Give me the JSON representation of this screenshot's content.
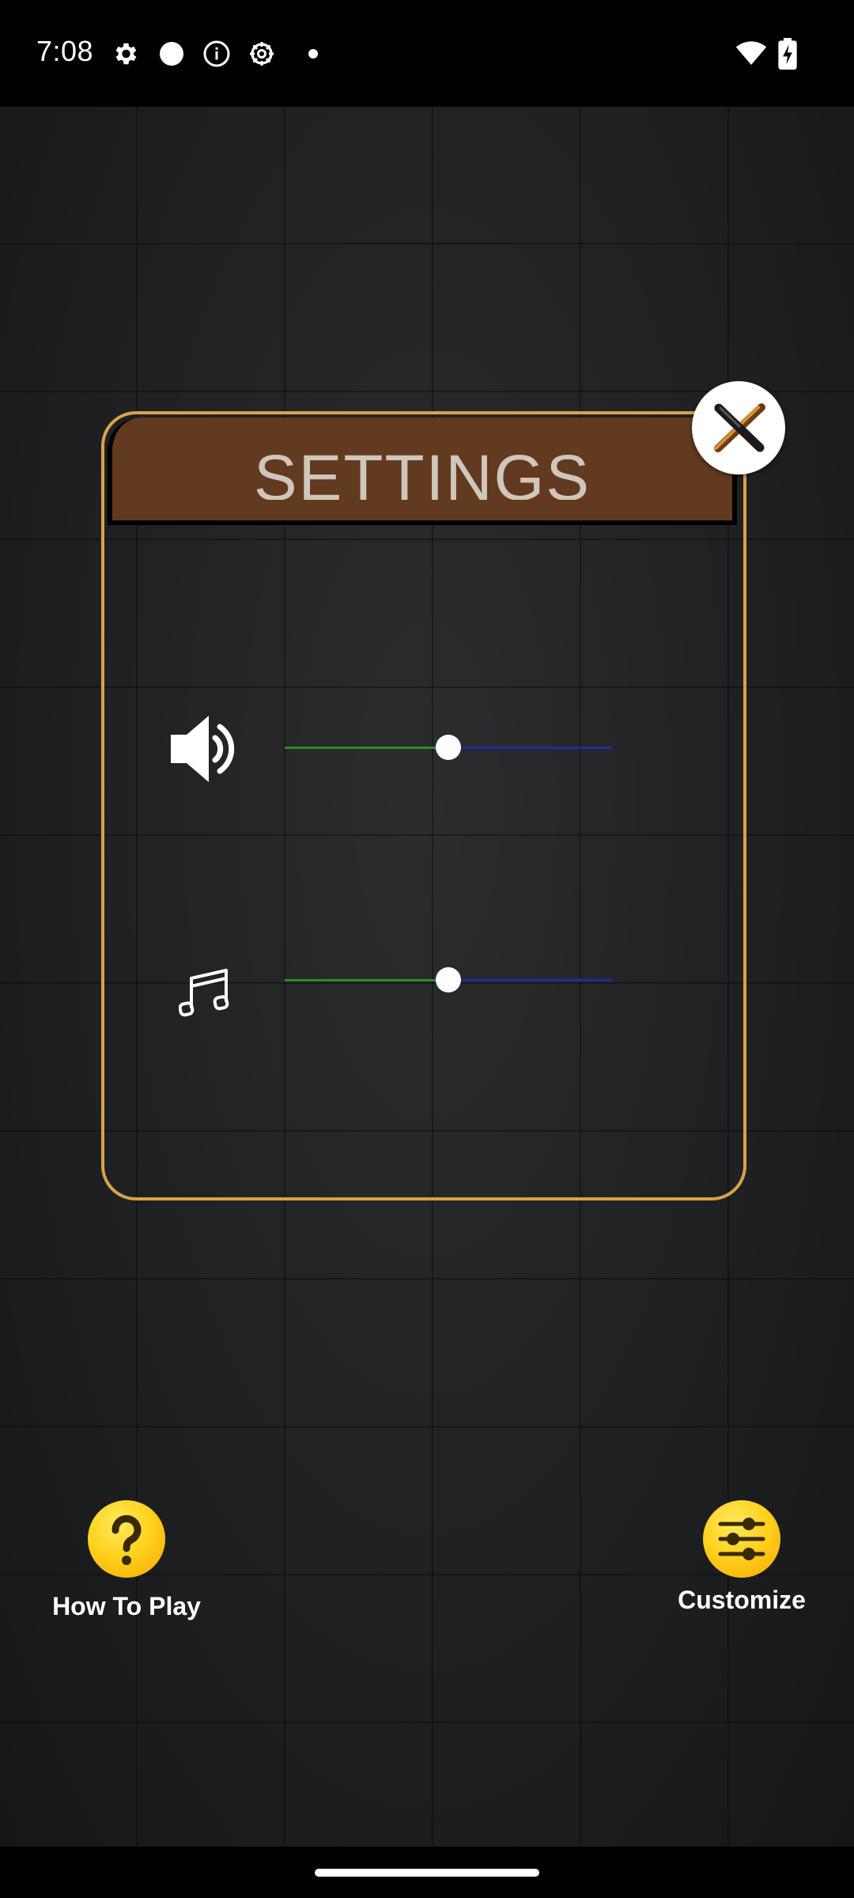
{
  "status_bar": {
    "time": "7:08",
    "icons": [
      "settings-icon",
      "circle-icon",
      "info-icon",
      "gear-badge-icon",
      "dot-icon",
      "wifi-icon",
      "battery-charging-icon"
    ]
  },
  "settings_panel": {
    "title": "SETTINGS",
    "close_icon": "close-pickaxe-icon",
    "sound": {
      "icon": "speaker-icon",
      "level": 0.5
    },
    "music": {
      "icon": "music-note-icon",
      "level": 0.5
    },
    "colors": {
      "border": "#d9a34a",
      "header": "#623a1f",
      "slider_active": "#2e8b1f",
      "slider_inactive": "#1e2aa8"
    }
  },
  "bottom_buttons": {
    "how_to_play": {
      "label": "How To Play",
      "icon": "question-emoji-icon"
    },
    "customize": {
      "label": "Customize",
      "icon": "sliders-emoji-icon"
    }
  }
}
